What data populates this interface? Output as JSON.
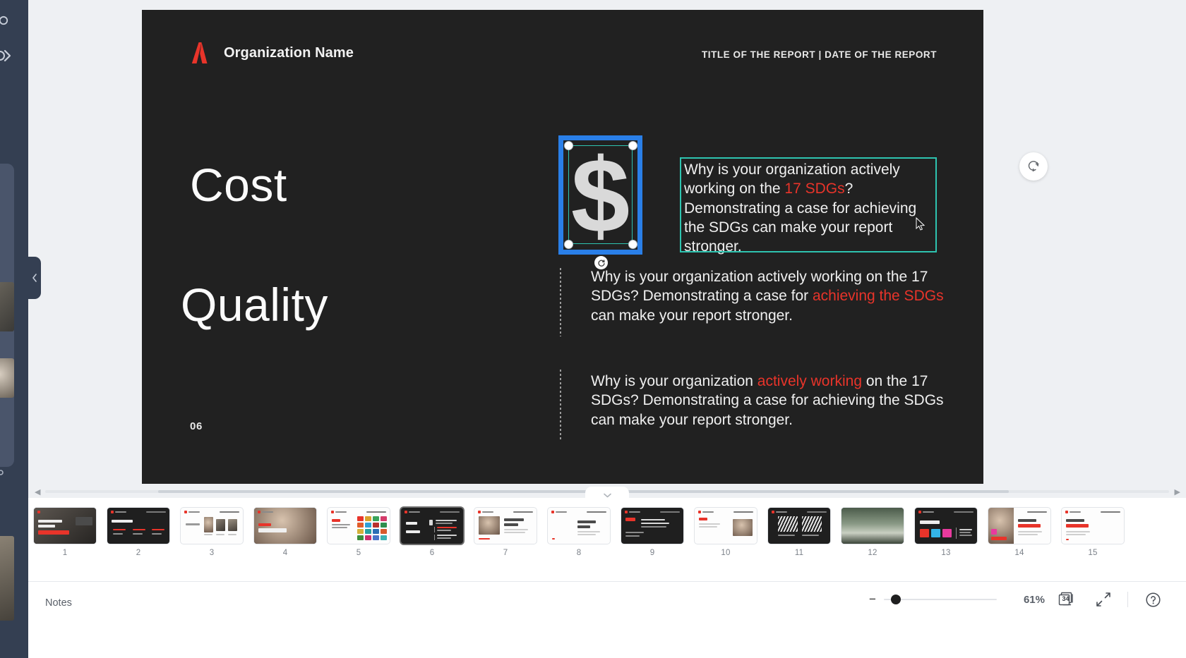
{
  "app": {
    "notes_label": "Notes",
    "zoom_value": "61%",
    "slide_count": "34"
  },
  "slide": {
    "brand_name": "Organization Name",
    "report_meta": "TITLE OF THE REPORT | DATE OF THE REPORT",
    "keyword_1": "Cost",
    "keyword_2": "Quality",
    "slide_number": "06",
    "dollar_symbol": "$",
    "text_block_1": {
      "part1": "Why is your organization actively working on the ",
      "accent1": "17 SDGs",
      "part2": "? Demonstrating a case for achieving the SDGs can make your report stronger."
    },
    "text_block_2": {
      "part1": "Why is your organization actively working on the 17 SDGs? Demonstrating a case for ",
      "accent1": "achieving the SDGs",
      "part2": " can make your report stronger."
    },
    "text_block_3": {
      "part1": "Why is your organization ",
      "accent1": "actively working",
      "part2": " on the 17 SDGs? Demonstrating a case for achieving the SDGs can make your report stronger."
    }
  },
  "colors": {
    "slide_background": "#212121",
    "accent_red": "#e8342a",
    "selection_blue": "#2a7fe8",
    "selection_teal": "#2ec4b0",
    "rail_navy": "#343f52"
  },
  "filmstrip": {
    "slides": [
      {
        "number": "1",
        "theme": "dark",
        "selected": false
      },
      {
        "number": "2",
        "theme": "dark",
        "selected": false
      },
      {
        "number": "3",
        "theme": "light",
        "selected": false
      },
      {
        "number": "4",
        "theme": "dark",
        "selected": false
      },
      {
        "number": "5",
        "theme": "light",
        "selected": false
      },
      {
        "number": "6",
        "theme": "dark",
        "selected": true
      },
      {
        "number": "7",
        "theme": "light",
        "selected": false
      },
      {
        "number": "8",
        "theme": "light",
        "selected": false
      },
      {
        "number": "9",
        "theme": "dark",
        "selected": false
      },
      {
        "number": "10",
        "theme": "light",
        "selected": false
      },
      {
        "number": "11",
        "theme": "dark",
        "selected": false
      },
      {
        "number": "12",
        "theme": "dark",
        "selected": false
      },
      {
        "number": "13",
        "theme": "dark",
        "selected": false
      },
      {
        "number": "14",
        "theme": "light",
        "selected": false
      },
      {
        "number": "15",
        "theme": "light",
        "selected": false
      }
    ]
  }
}
